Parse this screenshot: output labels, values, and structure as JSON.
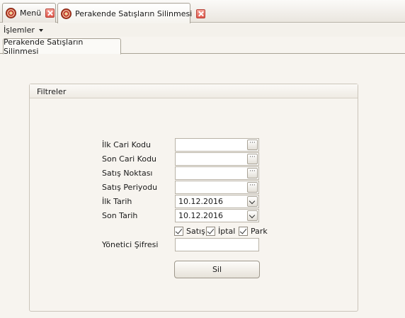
{
  "doc_tabs": [
    {
      "label": "Menü",
      "icon": "app-logo-icon"
    },
    {
      "label": "Perakende Satışların Silinmesi",
      "icon": "app-logo-icon"
    }
  ],
  "menu": {
    "islemler": "İşlemler"
  },
  "inner_tab": {
    "label": "Perakende Satışların Silinmesi"
  },
  "filters": {
    "title": "Filtreler",
    "ilk_cari_kodu": {
      "label": "İlk Cari Kodu",
      "value": ""
    },
    "son_cari_kodu": {
      "label": "Son Cari Kodu",
      "value": ""
    },
    "satis_noktasi": {
      "label": "Satış Noktası",
      "value": ""
    },
    "satis_periyodu": {
      "label": "Satış Periyodu",
      "value": ""
    },
    "ilk_tarih": {
      "label": "İlk Tarih",
      "value": "10.12.2016"
    },
    "son_tarih": {
      "label": "Son Tarih",
      "value": "10.12.2016"
    },
    "checkboxes": {
      "satis": {
        "label": "Satış",
        "checked": true
      },
      "iptal": {
        "label": "İptal",
        "checked": true
      },
      "park": {
        "label": "Park",
        "checked": true
      }
    },
    "yonetici_sifresi": {
      "label": "Yönetici Şifresi",
      "value": ""
    },
    "lookup_glyph": "···",
    "sil_label": "Sil"
  }
}
